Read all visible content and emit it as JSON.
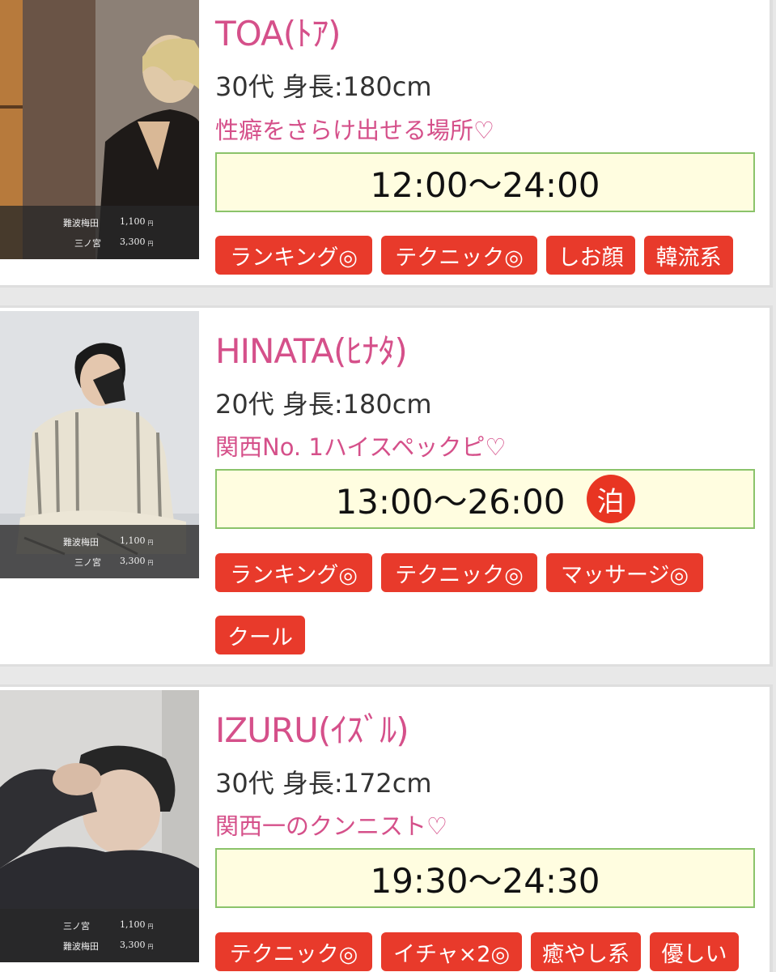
{
  "colors": {
    "accent_pink": "#d5508a",
    "tag_red": "#e83a2b",
    "hours_bg": "#fffde0",
    "hours_border": "#8bc36a"
  },
  "cards": [
    {
      "name": "TOA(ﾄｱ)",
      "spec": "30代 身長:180cm",
      "catch": "性癖をさらけ出せる場所♡",
      "hours": "12:00〜24:00",
      "prices": [
        {
          "area": "難波梅田",
          "price": "1,100"
        },
        {
          "area": "三ノ宮",
          "price": "3,300"
        }
      ],
      "tags": [
        "ランキング◎",
        "テクニック◎",
        "しお顔",
        "韓流系"
      ]
    },
    {
      "name": "HINATA(ﾋﾅﾀ)",
      "spec": "20代 身長:180cm",
      "catch": "関西No. 1ハイスペックピ♡",
      "hours": "13:00〜26:00",
      "stay_badge": "泊",
      "prices": [
        {
          "area": "難波梅田",
          "price": "1,100"
        },
        {
          "area": "三ノ宮",
          "price": "3,300"
        }
      ],
      "tags": [
        "ランキング◎",
        "テクニック◎",
        "マッサージ◎",
        "クール"
      ]
    },
    {
      "name": "IZURU(ｲｽﾞﾙ)",
      "spec": "30代 身長:172cm",
      "catch": "関西一のクンニスト♡",
      "hours": "19:30〜24:30",
      "prices": [
        {
          "area": "三ノ宮",
          "price": "1,100"
        },
        {
          "area": "難波梅田",
          "price": "3,300"
        }
      ],
      "tags": [
        "テクニック◎",
        "イチャ×2◎",
        "癒やし系",
        "優しい"
      ]
    }
  ],
  "currency_mark": "円"
}
